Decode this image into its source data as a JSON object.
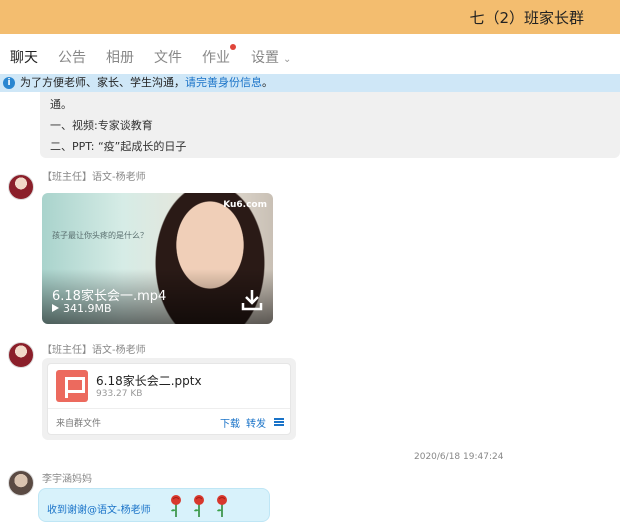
{
  "window": {
    "title": "七（2）班家长群"
  },
  "tabs": [
    {
      "label": "聊天"
    },
    {
      "label": "公告"
    },
    {
      "label": "相册"
    },
    {
      "label": "文件"
    },
    {
      "label": "作业"
    },
    {
      "label": "设置"
    }
  ],
  "notice": {
    "text": "为了方便老师、家长、学生沟通，",
    "link": "请完善身份信息",
    "end": "。"
  },
  "messages": {
    "partial": {
      "line1": "通。",
      "line2": "一、视频:专家谈教育",
      "line3": "二、PPT: “疫”起成长的日子"
    },
    "video_msg": {
      "sender": "【班主任】语文-杨老师",
      "caption": "孩子最让你头疼的是什么？",
      "watermark": "Ku6.com",
      "file_name": "6.18家长会一.mp4",
      "file_size": "341.9MB"
    },
    "file_msg": {
      "sender": "【班主任】语文-杨老师",
      "file_name": "6.18家长会二.pptx",
      "file_size": "933.27 KB",
      "source": "来自群文件",
      "download": "下载",
      "forward": "转发"
    },
    "timestamp": "2020/6/18 19:47:24",
    "reply": {
      "sender": "李宇涵妈妈",
      "text": "收到谢谢@语文-杨老师"
    }
  },
  "colors": {
    "titlebar": "#f3bd6f",
    "notice_bg": "#cfe7f7",
    "link": "#1a73c8",
    "bubble": "#d8f2fb"
  }
}
